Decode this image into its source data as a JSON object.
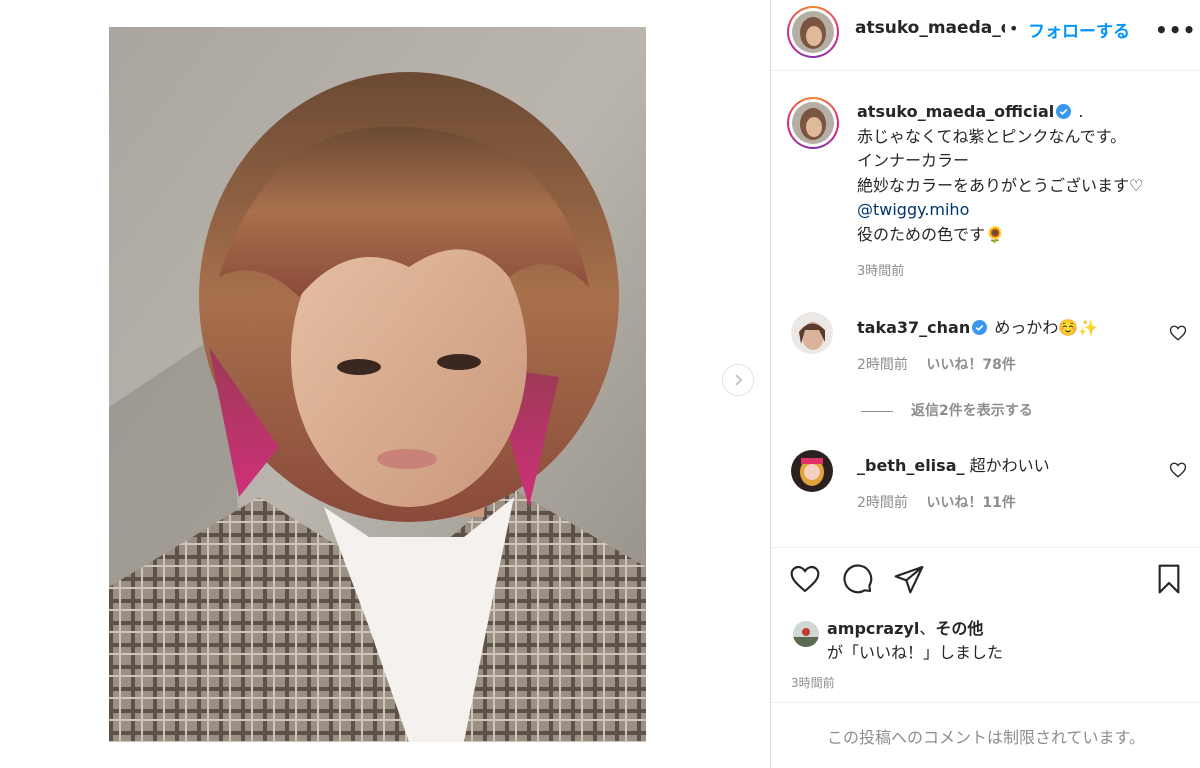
{
  "post_header": {
    "username": "atsuko_maeda_official",
    "separator": "•",
    "follow_label": "フォローする",
    "more_label": "•••"
  },
  "caption": {
    "username": "atsuko_maeda_official",
    "lines": [
      ".",
      "赤じゃなくてね紫とピンクなんです。",
      "インナーカラー",
      "絶妙なカラーをありがとうございます♡",
      "@twiggy.miho",
      "役のための色です🌻"
    ],
    "time": "3時間前"
  },
  "comments": [
    {
      "username": "taka37_chan",
      "verified": true,
      "text": "めっかわ☺️✨",
      "time": "2時間前",
      "likes": "いいね！78件",
      "replies_label": "返信2件を表示する"
    },
    {
      "username": "_beth_elisa_",
      "verified": false,
      "text": "超かわいい",
      "time": "2時間前",
      "likes": "いいね！11件"
    }
  ],
  "actions": {
    "icons": [
      "heart-icon",
      "comment-icon",
      "share-icon",
      "bookmark-icon"
    ]
  },
  "likes_summary": {
    "users": "ampcrazyl",
    "connector": "、",
    "others": "その他",
    "suffix": "が「いいね！」しました"
  },
  "post_time": "3時間前",
  "comment_restricted": "この投稿へのコメントは制限されています。",
  "colors": {
    "link_blue": "#0095f6",
    "mention_blue": "#00376b",
    "verified_blue": "#3897f0",
    "muted_gray": "#8e8e8e"
  }
}
